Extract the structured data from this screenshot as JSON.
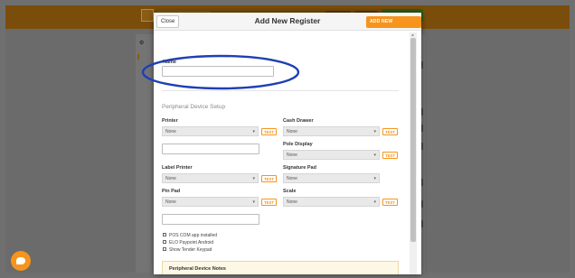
{
  "modal": {
    "close_label": "Close",
    "title": "Add New Register",
    "add_button_label": "ADD NEW REGISTER"
  },
  "form": {
    "name_label": "Name",
    "name_value": "",
    "section_title": "Peripheral Device Setup",
    "printer": {
      "label": "Printer",
      "value": "None",
      "test_label": "TEST"
    },
    "printer_extra_value": "",
    "cash_drawer": {
      "label": "Cash Drawer",
      "value": "None",
      "test_label": "TEST"
    },
    "pole_display": {
      "label": "Pole Display",
      "value": "None",
      "test_label": "TEST"
    },
    "label_printer": {
      "label": "Label Printer",
      "value": "None",
      "test_label": "TEST"
    },
    "signature_pad": {
      "label": "Signature Pad",
      "value": "None"
    },
    "pin_pad": {
      "label": "Pin Pad",
      "value": "None",
      "test_label": "TEST"
    },
    "pin_pad_extra_value": "",
    "scale": {
      "label": "Scale",
      "value": "None",
      "test_label": "TEST"
    },
    "checkboxes": [
      {
        "label": "POS COM app installed",
        "checked": false
      },
      {
        "label": "ELO Paypoint Android",
        "checked": false
      },
      {
        "label": "Show Tender Keypad",
        "checked": false
      }
    ],
    "notes_title": "Peripheral Device Notes"
  },
  "colors": {
    "accent": "#f7941d",
    "annotation": "#1f3fb5"
  },
  "icons": {
    "caret": "chevron-down-icon",
    "chat": "chat-icon"
  }
}
